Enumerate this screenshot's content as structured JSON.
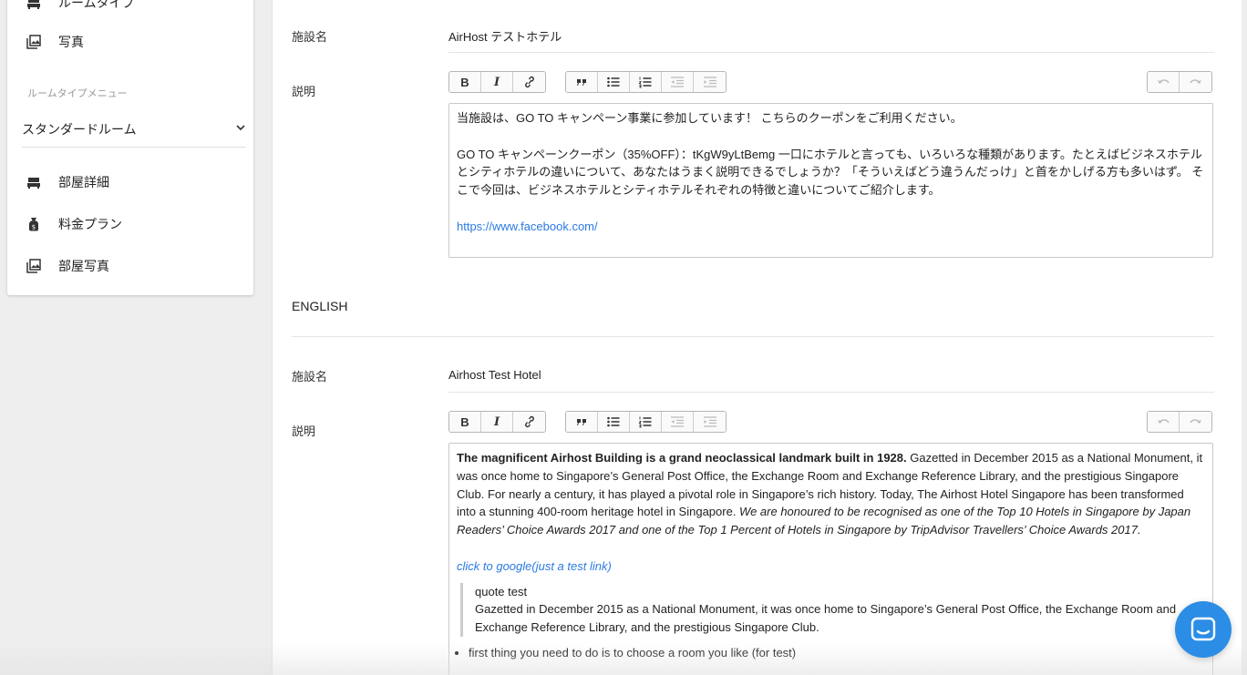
{
  "sidebar": {
    "items_top": [
      {
        "label": "ルームタイプ",
        "icon": "bed-icon"
      },
      {
        "label": "写真",
        "icon": "photos-icon"
      }
    ],
    "section_label": "ルームタイプメニュー",
    "room_select": {
      "value": "スタンダードルーム"
    },
    "items_room": [
      {
        "label": "部屋詳細",
        "icon": "bed-icon"
      },
      {
        "label": "料金プラン",
        "icon": "money-bag-icon"
      },
      {
        "label": "部屋写真",
        "icon": "photos-icon"
      }
    ]
  },
  "japanese": {
    "name_label": "施設名",
    "name_value": "AirHost テストホテル",
    "desc_label": "説明",
    "desc": {
      "p1": "当施設は、GO TO キャンペーン事業に参加しています！ こちらのクーポンをご利用ください。",
      "p2": "GO TO キャンペーンクーポン（35%OFF）：tKgW9yLtBemg 一口にホテルと言っても、いろいろな種類があります。たとえばビジネスホテルとシティホテルの違いについて、あなたはうまく説明できるでしょうか？「そういえばどう違うんだっけ」と首をかしげる方も多いはず。 そこで今回は、ビジネスホテルとシティホテルそれぞれの特徴と違いについてご紹介します。",
      "link": "https://www.facebook.com/"
    }
  },
  "english": {
    "section_title": "ENGLISH",
    "name_label": "施設名",
    "name_value": "Airhost Test Hotel",
    "desc_label": "説明",
    "desc": {
      "bold_lead": "The magnificent Airhost Building is a grand neoclassical landmark built in 1928.",
      "body": " Gazetted in December 2015 as a National Monument, it was once home to Singapore’s General Post Office, the Exchange Room and Exchange Reference Library, and the prestigious Singapore Club. For nearly a century, it has played a pivotal role in Singapore’s rich history. Today, The Airhost Hotel Singapore has been transformed into a stunning 400-room heritage hotel in Singapore. ",
      "italic": "We are honoured to be recognised as one of the Top 10 Hotels in Singapore by Japan Readers’ Choice Awards 2017 and one of the Top 1 Percent of Hotels in Singapore by TripAdvisor Travellers’ Choice Awards 2017.",
      "link": "click to google(just a test link)",
      "quote_title": "quote test",
      "quote_body": "Gazetted in December 2015 as a National Monument, it was once home to Singapore’s General Post Office, the Exchange Room and Exchange Reference Library, and the prestigious Singapore Club.",
      "list_item_1": "first thing you need to do is to choose a room you like (for test)"
    }
  },
  "toolbar": {
    "bold": "B",
    "italic": "I"
  },
  "colors": {
    "accent": "#2b8de6",
    "link": "#2a7ae2"
  }
}
